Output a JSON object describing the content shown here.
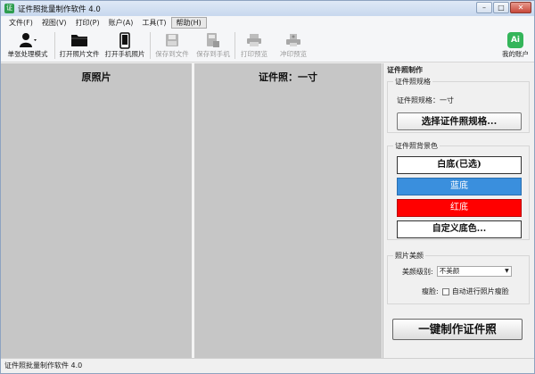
{
  "window": {
    "title": "证件照批量制作软件 4.0",
    "app_icon": "证"
  },
  "window_controls": {
    "minimize": "–",
    "maximize": "□",
    "close": "✕"
  },
  "menu": {
    "items": [
      "文件(F)",
      "视图(V)",
      "打印(P)",
      "账户(A)",
      "工具(T)",
      "帮助(H)"
    ],
    "active_index": 5
  },
  "toolbar": {
    "single_mode": "单张处理模式",
    "open_photo_file": "打开照片文件",
    "open_phone_photo": "打开手机照片",
    "save_to_file": "保存到文件",
    "save_to_phone": "保存到手机",
    "print_preview": "打印预览",
    "wash_preview": "冲印预览",
    "account_badge": "Ai",
    "my_account": "我的账户"
  },
  "panes": {
    "original": "原照片",
    "id_photo": "证件照：一寸"
  },
  "panel": {
    "header": "证件照制作",
    "spec_group": {
      "title": "证件照规格",
      "spec_label": "证件照规格：一寸",
      "choose_button": "选择证件照规格..."
    },
    "bg_group": {
      "title": "证件照背景色",
      "white": "白底(已选)",
      "blue": "蓝底",
      "red": "红底",
      "custom": "自定义底色..."
    },
    "beauty_group": {
      "title": "照片美颜",
      "level_label": "美颜级别:",
      "level_value": "不美颜",
      "slim_label": "瘦脸:",
      "slim_checkbox_label": "自动进行照片瘦脸",
      "slim_checked": false
    },
    "make_button": "一键制作证件照"
  },
  "colors": {
    "blue_bg": "#3a8fdd",
    "red_bg": "#ff0000",
    "accent_green": "#34b55a"
  },
  "status": {
    "text": "证件照批量制作软件 4.0"
  }
}
